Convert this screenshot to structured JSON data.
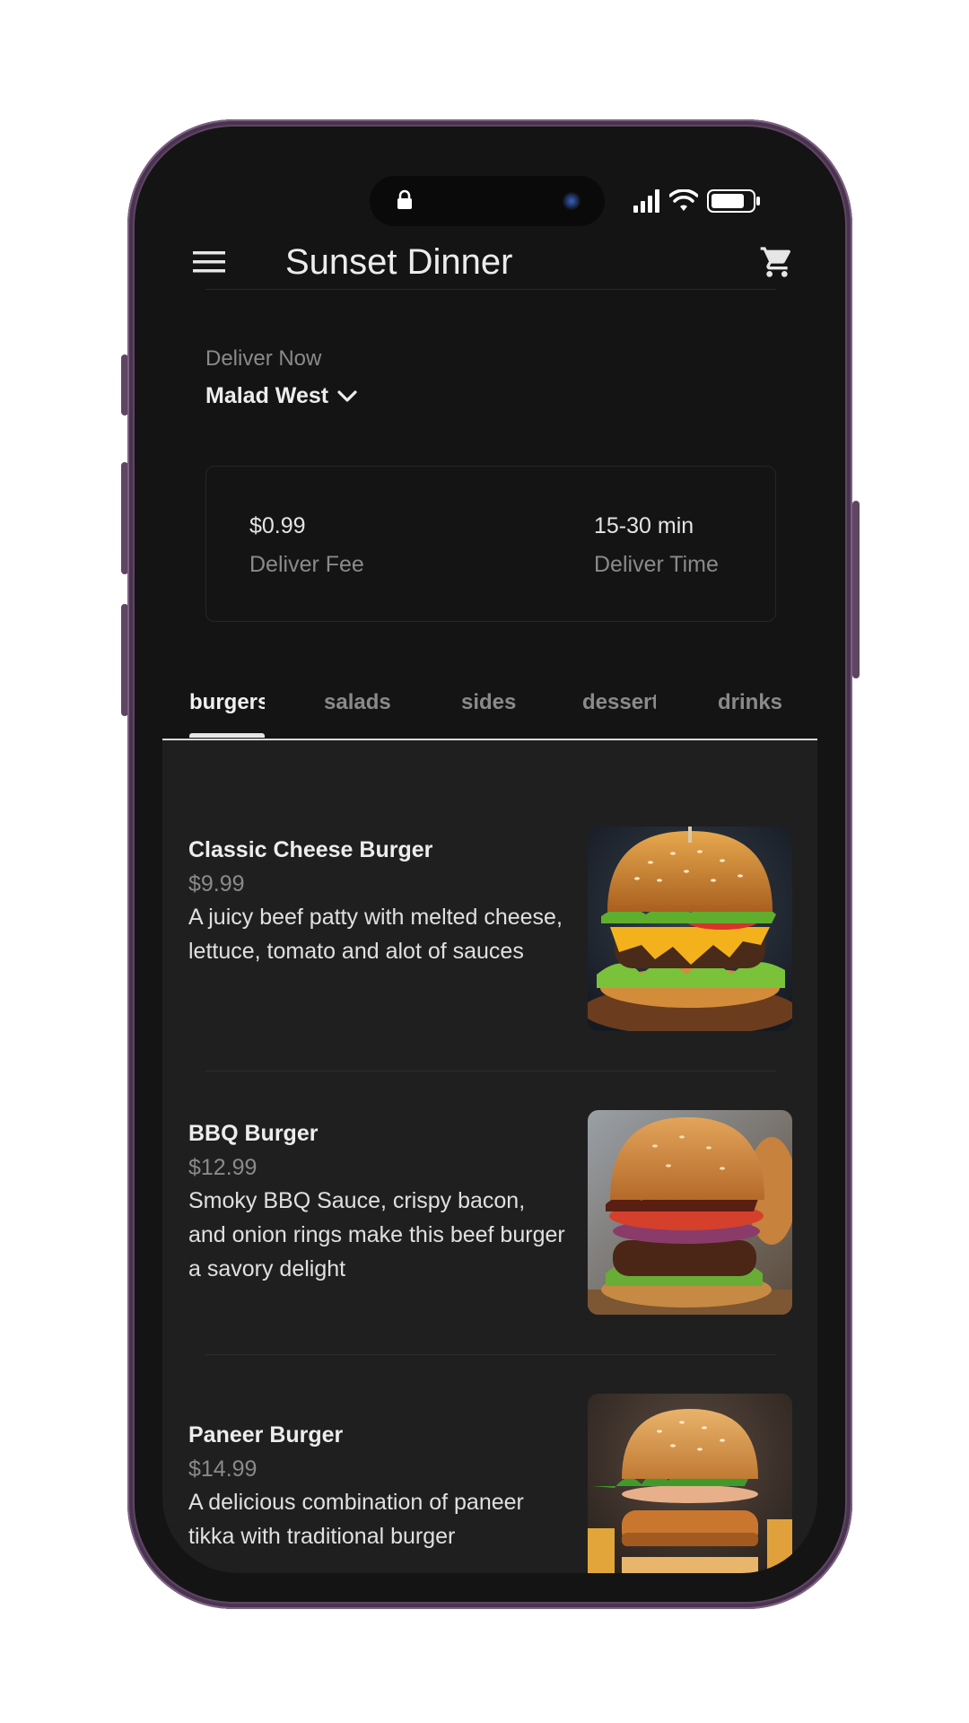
{
  "status_bar": {
    "icons": [
      "lock-icon",
      "camera-icon",
      "signal-icon",
      "wifi-icon",
      "battery-icon"
    ]
  },
  "app_bar": {
    "title": "Sunset Dinner",
    "icons": [
      "menu-icon",
      "cart-icon"
    ]
  },
  "delivery": {
    "label": "Deliver Now",
    "location": "Malad West",
    "icon": "chevron-down-icon"
  },
  "info_card": {
    "fee_value": "$0.99",
    "fee_label": "Deliver Fee",
    "time_value": "15-30 min",
    "time_label": "Deliver Time"
  },
  "tabs": [
    {
      "label": "burgers",
      "active": true
    },
    {
      "label": "salads",
      "active": false
    },
    {
      "label": "sides",
      "active": false
    },
    {
      "label": "desserts",
      "active": false
    },
    {
      "label": "drinks",
      "active": false
    }
  ],
  "menu_items": [
    {
      "title": "Classic Cheese Burger",
      "price": "$9.99",
      "description": "A juicy beef patty with melted cheese, lettuce, tomato and alot of sauces",
      "image": "classic-cheese-burger-photo"
    },
    {
      "title": "BBQ Burger",
      "price": "$12.99",
      "description": "Smoky BBQ Sauce, crispy bacon, and onion rings make this beef burger a savory delight",
      "image": "bbq-burger-photo"
    },
    {
      "title": "Paneer Burger",
      "price": "$14.99",
      "description": "A delicious combination of paneer tikka with traditional burger",
      "image": "paneer-burger-photo"
    }
  ],
  "colors": {
    "frame": "#5e4663",
    "background": "#141414",
    "list_background": "#1f1f1f",
    "text_primary": "#ededed",
    "text_secondary": "#8a8a8a"
  }
}
